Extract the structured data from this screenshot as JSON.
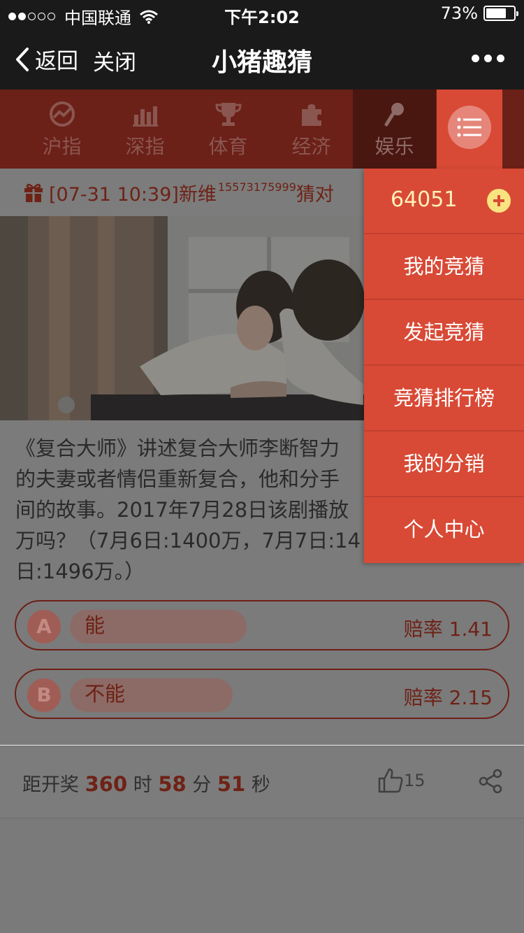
{
  "status_bar": {
    "carrier": "中国联通",
    "time": "下午2:02",
    "battery_label": "73%",
    "battery_level": 0.73,
    "signal_bars_filled": 2,
    "signal_bars_total": 5
  },
  "nav": {
    "back_label": "返回",
    "close_label": "关闭",
    "title": "小猪趣猜"
  },
  "categories": [
    {
      "label": "沪指",
      "icon": "trend-icon"
    },
    {
      "label": "深指",
      "icon": "bar-chart-icon"
    },
    {
      "label": "体育",
      "icon": "trophy-icon"
    },
    {
      "label": "经济",
      "icon": "puzzle-icon"
    },
    {
      "label": "娱乐",
      "icon": "microphone-icon",
      "active": true
    }
  ],
  "ticker": {
    "text": "[07-31 10:39]新维",
    "superscript": "15573175999",
    "trailing": "猜对"
  },
  "question": {
    "lines": [
      "《复合大师》讲述复合大师李断智力",
      "的夫妻或者情侣重新复合，他和分手",
      "间的故事。2017年7月28日该剧播放",
      "万吗？（7月6日:1400万，7月7日:14",
      "日:1496万。）"
    ]
  },
  "options": [
    {
      "letter": "A",
      "label": "能",
      "odds": "赔率 1.41"
    },
    {
      "letter": "B",
      "label": "不能",
      "odds": "赔率 2.15"
    }
  ],
  "footer": {
    "prefix": "距开奖",
    "hours": "360",
    "hours_unit": "时",
    "minutes": "58",
    "minutes_unit": "分",
    "seconds": "51",
    "seconds_unit": "秒",
    "like_count": "15"
  },
  "menu": {
    "balance": "64051",
    "items": [
      "我的竞猜",
      "发起竞猜",
      "竞猜排行榜",
      "我的分销",
      "个人中心"
    ]
  },
  "colors": {
    "accent": "#d84a36",
    "balance_text": "#fff1b8",
    "plus_badge": "#f9e37f"
  }
}
